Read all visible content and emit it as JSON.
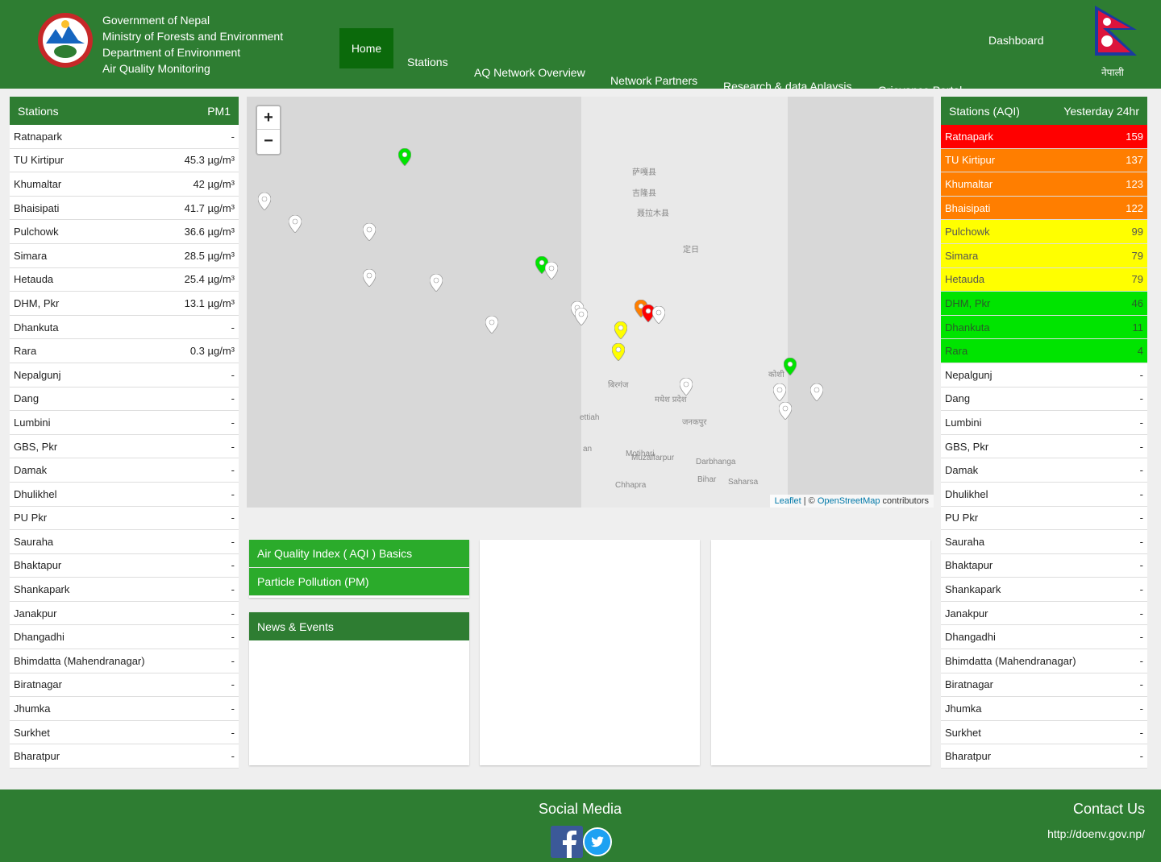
{
  "header": {
    "brand_lines": [
      "Government of Nepal",
      "Ministry of Forests and Environment",
      "Department of Environment",
      "Air Quality Monitoring"
    ],
    "nav": [
      "Home",
      "Stations",
      "AQ Network Overview",
      "Network Partners",
      "Research & data Anlaysis",
      "Grievance Portal",
      "Dashboard"
    ],
    "language_label": "नेपाली"
  },
  "left_table": {
    "col1": "Stations",
    "col2": "PM1",
    "rows": [
      {
        "name": "Ratnapark",
        "value": "-"
      },
      {
        "name": "TU Kirtipur",
        "value": "45.3 µg/m³"
      },
      {
        "name": "Khumaltar",
        "value": "42 µg/m³"
      },
      {
        "name": "Bhaisipati",
        "value": "41.7 µg/m³"
      },
      {
        "name": "Pulchowk",
        "value": "36.6 µg/m³"
      },
      {
        "name": "Simara",
        "value": "28.5 µg/m³"
      },
      {
        "name": "Hetauda",
        "value": "25.4 µg/m³"
      },
      {
        "name": "DHM, Pkr",
        "value": "13.1 µg/m³"
      },
      {
        "name": "Dhankuta",
        "value": "-"
      },
      {
        "name": "Rara",
        "value": "0.3 µg/m³"
      },
      {
        "name": "Nepalgunj",
        "value": "-"
      },
      {
        "name": "Dang",
        "value": "-"
      },
      {
        "name": "Lumbini",
        "value": "-"
      },
      {
        "name": "GBS, Pkr",
        "value": "-"
      },
      {
        "name": "Damak",
        "value": "-"
      },
      {
        "name": "Dhulikhel",
        "value": "-"
      },
      {
        "name": "PU Pkr",
        "value": "-"
      },
      {
        "name": "Sauraha",
        "value": "-"
      },
      {
        "name": "Bhaktapur",
        "value": "-"
      },
      {
        "name": "Shankapark",
        "value": "-"
      },
      {
        "name": "Janakpur",
        "value": "-"
      },
      {
        "name": "Dhangadhi",
        "value": "-"
      },
      {
        "name": "Bhimdatta (Mahendranagar)",
        "value": "-"
      },
      {
        "name": "Biratnagar",
        "value": "-"
      },
      {
        "name": "Jhumka",
        "value": "-"
      },
      {
        "name": "Surkhet",
        "value": "-"
      },
      {
        "name": "Bharatpur",
        "value": "-"
      }
    ]
  },
  "right_table": {
    "col1": "Stations (AQI)",
    "col2": "Yesterday 24hr",
    "colors": {
      "red": "#ff0000",
      "orange": "#ff7e00",
      "yellow": "#ffff00",
      "green": "#00e400"
    },
    "rows": [
      {
        "name": "Ratnapark",
        "value": "159",
        "level": "red"
      },
      {
        "name": "TU Kirtipur",
        "value": "137",
        "level": "orange"
      },
      {
        "name": "Khumaltar",
        "value": "123",
        "level": "orange"
      },
      {
        "name": "Bhaisipati",
        "value": "122",
        "level": "orange"
      },
      {
        "name": "Pulchowk",
        "value": "99",
        "level": "yellow"
      },
      {
        "name": "Simara",
        "value": "79",
        "level": "yellow"
      },
      {
        "name": "Hetauda",
        "value": "79",
        "level": "yellow"
      },
      {
        "name": "DHM, Pkr",
        "value": "46",
        "level": "green"
      },
      {
        "name": "Dhankuta",
        "value": "11",
        "level": "green"
      },
      {
        "name": "Rara",
        "value": "4",
        "level": "green"
      },
      {
        "name": "Nepalgunj",
        "value": "-",
        "level": "none"
      },
      {
        "name": "Dang",
        "value": "-",
        "level": "none"
      },
      {
        "name": "Lumbini",
        "value": "-",
        "level": "none"
      },
      {
        "name": "GBS, Pkr",
        "value": "-",
        "level": "none"
      },
      {
        "name": "Damak",
        "value": "-",
        "level": "none"
      },
      {
        "name": "Dhulikhel",
        "value": "-",
        "level": "none"
      },
      {
        "name": "PU Pkr",
        "value": "-",
        "level": "none"
      },
      {
        "name": "Sauraha",
        "value": "-",
        "level": "none"
      },
      {
        "name": "Bhaktapur",
        "value": "-",
        "level": "none"
      },
      {
        "name": "Shankapark",
        "value": "-",
        "level": "none"
      },
      {
        "name": "Janakpur",
        "value": "-",
        "level": "none"
      },
      {
        "name": "Dhangadhi",
        "value": "-",
        "level": "none"
      },
      {
        "name": "Bhimdatta (Mahendranagar)",
        "value": "-",
        "level": "none"
      },
      {
        "name": "Biratnagar",
        "value": "-",
        "level": "none"
      },
      {
        "name": "Jhumka",
        "value": "-",
        "level": "none"
      },
      {
        "name": "Surkhet",
        "value": "-",
        "level": "none"
      },
      {
        "name": "Bharatpur",
        "value": "-",
        "level": "none"
      }
    ]
  },
  "map": {
    "zoom_in": "+",
    "zoom_out": "−",
    "attribution_leaflet": "Leaflet",
    "attribution_sep": " | © ",
    "attribution_osm": "OpenStreetMap",
    "attribution_tail": " contributors",
    "place_labels": [
      "萨嘎县",
      "吉隆县",
      "聂拉木县",
      "定日",
      "Motihari",
      "Muzaffarpur",
      "Darbhanga",
      "Saharsa",
      "Chhapra",
      "Bihar",
      "ettiah",
      "an",
      "बिरगंज",
      "जनकपुर",
      "मधेश प्रदेश",
      "कोशी"
    ]
  },
  "links": {
    "aqi_basics": "Air Quality Index ( AQI ) Basics",
    "pm": "Particle Pollution (PM)",
    "news": "News & Events"
  },
  "footer": {
    "social": "Social Media",
    "contact": "Contact Us",
    "url": "http://doenv.gov.np/"
  }
}
